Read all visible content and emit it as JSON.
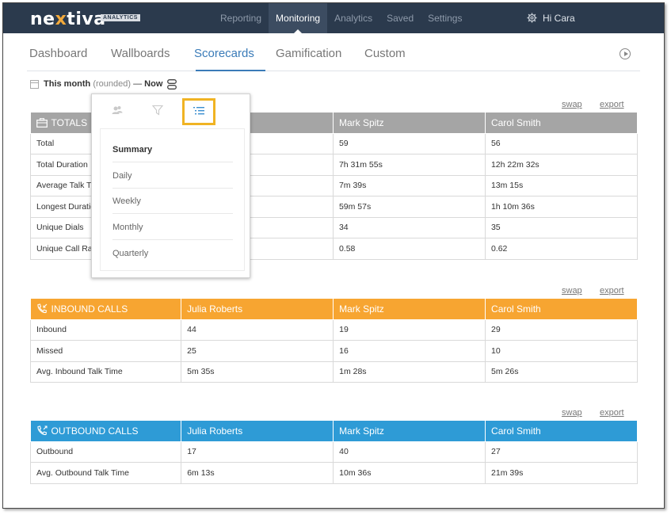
{
  "brand": {
    "name_left": "ne",
    "name_x": "x",
    "name_right": "tiva",
    "tag": "ANALYTICS"
  },
  "topnav": [
    "Reporting",
    "Monitoring",
    "Analytics",
    "Saved",
    "Settings"
  ],
  "topnav_active": "Monitoring",
  "greeting": "Hi Cara",
  "subtabs": [
    "Dashboard",
    "Wallboards",
    "Scorecards",
    "Gamification",
    "Custom"
  ],
  "subtab_active": "Scorecards",
  "date": {
    "start": "This month",
    "qualifier": "(rounded)",
    "dash": "—",
    "end": "Now"
  },
  "links": {
    "swap": "swap",
    "export": "export"
  },
  "totals": {
    "title": "TOTALS",
    "agents": [
      "",
      "Mark Spitz",
      "Carol Smith"
    ],
    "rows": [
      [
        "Total",
        "",
        "59",
        "56"
      ],
      [
        "Total Duration",
        "",
        "7h 31m 55s",
        "12h 22m 32s"
      ],
      [
        "Average Talk Ti",
        "",
        "7m 39s",
        "13m 15s"
      ],
      [
        "Longest Duratio",
        "",
        "59m 57s",
        "1h 10m 36s"
      ],
      [
        "Unique Dials",
        "",
        "34",
        "35"
      ],
      [
        "Unique Call Rat",
        "",
        "0.58",
        "0.62"
      ]
    ]
  },
  "inbound": {
    "title": "INBOUND CALLS",
    "agents": [
      "Julia Roberts",
      "Mark Spitz",
      "Carol Smith"
    ],
    "rows": [
      [
        "Inbound",
        "44",
        "19",
        "29"
      ],
      [
        "Missed",
        "25",
        "16",
        "10"
      ],
      [
        "Avg. Inbound Talk Time",
        "5m 35s",
        "1m 28s",
        "5m 26s"
      ]
    ]
  },
  "outbound": {
    "title": "OUTBOUND CALLS",
    "agents": [
      "Julia Roberts",
      "Mark Spitz",
      "Carol Smith"
    ],
    "rows": [
      [
        "Outbound",
        "17",
        "40",
        "27"
      ],
      [
        "Avg. Outbound Talk Time",
        "6m 13s",
        "10m 36s",
        "21m 39s"
      ]
    ]
  },
  "popover": {
    "items": [
      "Summary",
      "Daily",
      "Weekly",
      "Monthly",
      "Quarterly"
    ],
    "selected": "Summary"
  },
  "colors": {
    "nav": "#2b3a4d",
    "accent": "#3a7bb8",
    "totals": "#a5a5a5",
    "inbound": "#f7a531",
    "outbound": "#2e9bd6",
    "highlight": "#f0b323"
  }
}
